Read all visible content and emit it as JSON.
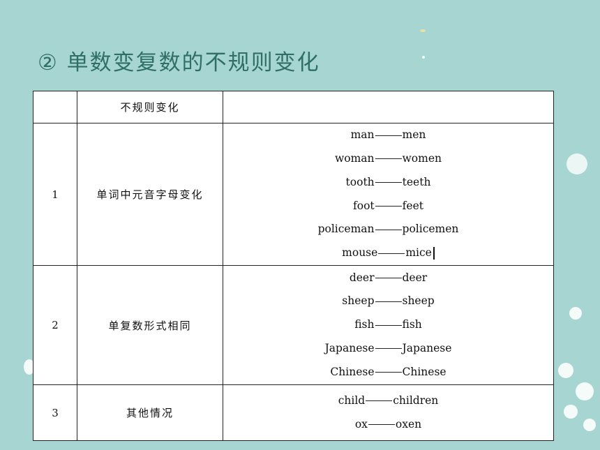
{
  "title": "② 单数变复数的不规则变化",
  "table": {
    "header": [
      "",
      "不规则变化",
      ""
    ],
    "rows": [
      {
        "num": "1",
        "rule": "单词中元音字母变化",
        "pairs": [
          [
            "man",
            "men"
          ],
          [
            "woman",
            "women"
          ],
          [
            "tooth",
            "teeth"
          ],
          [
            "foot",
            "feet"
          ],
          [
            "policeman",
            "policemen"
          ],
          [
            "mouse",
            "mice"
          ]
        ]
      },
      {
        "num": "2",
        "rule": "单复数形式相同",
        "pairs": [
          [
            "deer",
            "deer"
          ],
          [
            "sheep",
            "sheep"
          ],
          [
            "fish",
            "fish"
          ],
          [
            "Japanese",
            "Japanese"
          ],
          [
            "Chinese",
            "Chinese"
          ]
        ]
      },
      {
        "num": "3",
        "rule": "其他情况",
        "pairs": [
          [
            "child",
            "children"
          ],
          [
            "ox",
            "oxen"
          ]
        ]
      }
    ]
  }
}
